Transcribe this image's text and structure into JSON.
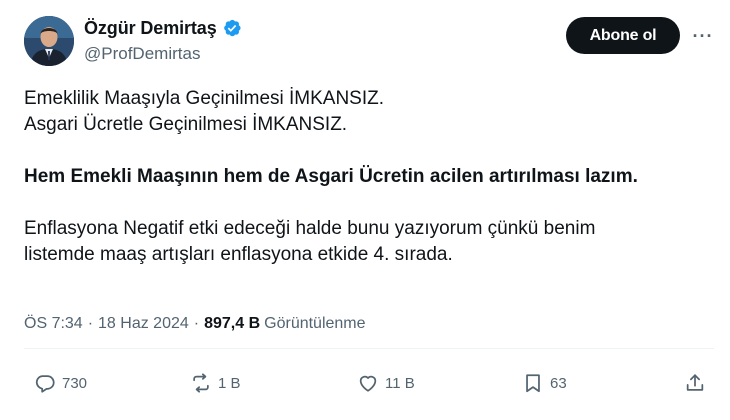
{
  "author": {
    "display_name": "Özgür Demirtaş",
    "handle": "@ProfDemirtas"
  },
  "header": {
    "follow_label": "Abone ol",
    "more_label": "···"
  },
  "tweet": {
    "line1": "Emeklilik Maaşıyla Geçinilmesi İMKANSIZ.",
    "line2": "Asgari Ücretle Geçinilmesi İMKANSIZ.",
    "line3": "Hem Emekli Maaşının hem de Asgari Ücretin acilen artırılması lazım.",
    "line4": "Enflasyona Negatif etki edeceği halde bunu yazıyorum çünkü benim",
    "line5": "listemde maaş artışları enflasyona etkide 4. sırada."
  },
  "meta": {
    "time": "ÖS 7:34",
    "separator": "·",
    "date": "18 Haz 2024",
    "views_count": "897,4 B",
    "views_label": "Görüntülenme"
  },
  "actions": {
    "replies": "730",
    "reposts": "1 B",
    "likes": "11 B",
    "bookmarks": "63"
  },
  "colors": {
    "text": "#0f1419",
    "secondary": "#536471",
    "verified": "#1d9bf0",
    "button_bg": "#0f1419"
  },
  "icons": {
    "verified": "verified-badge-icon",
    "reply": "reply-icon",
    "repost": "repost-icon",
    "like": "heart-icon",
    "bookmark": "bookmark-icon",
    "share": "share-icon",
    "more": "more-icon"
  }
}
